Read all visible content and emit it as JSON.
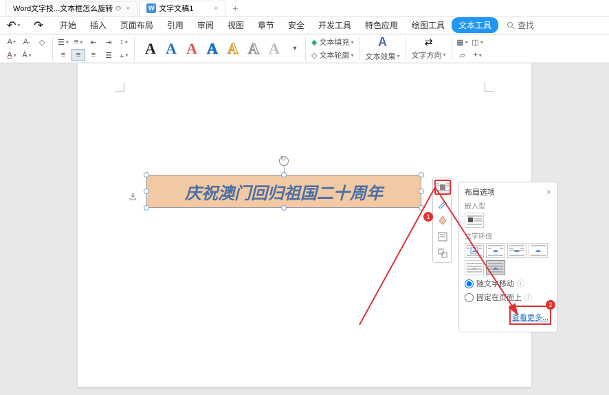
{
  "tabs": {
    "tab1": {
      "label": "Word文字技...文本框怎么旋转"
    },
    "tab2": {
      "label": "文字文稿1",
      "icon_letter": "W"
    }
  },
  "menu": {
    "start": "开始",
    "insert": "插入",
    "page_layout": "页面布局",
    "references": "引用",
    "review": "审阅",
    "view": "视图",
    "chapter": "章节",
    "security": "安全",
    "dev_tools": "开发工具",
    "special": "特色应用",
    "drawing": "绘图工具",
    "text_tools": "文本工具",
    "search_placeholder": "查找"
  },
  "toolbar": {
    "text_fill": "文本填充",
    "text_outline": "文本轮廓",
    "text_effects": "文本效果",
    "text_direction": "文字方向"
  },
  "style_gallery_letter": "A",
  "document": {
    "textbox_content": "庆祝澳门回归祖国二十周年"
  },
  "float_toolbar": {
    "btn_layout": "layout-options-icon",
    "btn_outline": "outline-icon",
    "btn_rotate": "rotate-icon",
    "btn_wrap": "wrap-icon",
    "btn_group": "group-icon"
  },
  "layout_panel": {
    "title": "布局选项",
    "inline_label": "嵌入型",
    "wrap_label": "文字环绕",
    "move_with_text": "随文字移动",
    "fixed_position": "固定在页面上",
    "more": "查看更多..."
  },
  "annotations": {
    "badge1": "1",
    "badge2": "2"
  }
}
